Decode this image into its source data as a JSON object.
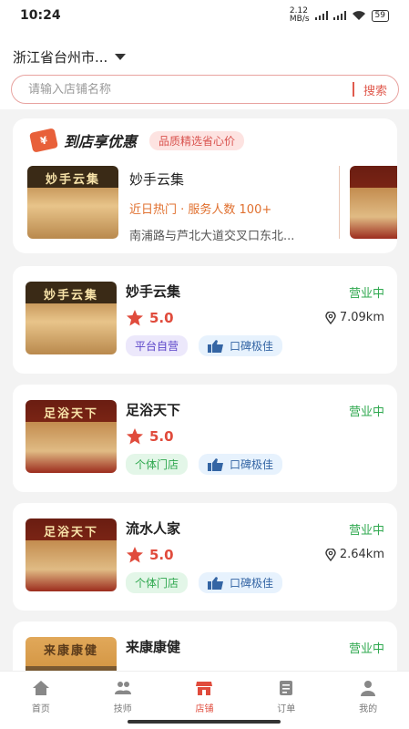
{
  "status_bar": {
    "time": "10:24",
    "net_speed": "2.12\nMB/s",
    "battery": "59"
  },
  "header": {
    "location": "浙江省台州市...",
    "search_placeholder": "请输入店铺名称",
    "search_button": "搜索"
  },
  "promo": {
    "title": "到店享优惠",
    "tag": "品质精选省心价",
    "store": {
      "name": "妙手云集",
      "hot": "近日热门 · 服务人数 100+",
      "address": "南浦路与芦北大道交叉口东北..."
    }
  },
  "stores": [
    {
      "name": "妙手云集",
      "status": "营业中",
      "rating": "5.0",
      "distance": "7.09km",
      "sign": "妙手云集",
      "tags": [
        "平台自营",
        "口碑极佳"
      ]
    },
    {
      "name": "足浴天下",
      "status": "营业中",
      "rating": "5.0",
      "distance": "",
      "sign": "足浴天下",
      "tags": [
        "个体门店",
        "口碑极佳"
      ]
    },
    {
      "name": "流水人家",
      "status": "营业中",
      "rating": "5.0",
      "distance": "2.64km",
      "sign": "足浴天下",
      "tags": [
        "个体门店",
        "口碑极佳"
      ]
    },
    {
      "name": "来康康健",
      "status": "营业中",
      "sign": "来康康健"
    }
  ],
  "tabbar": [
    {
      "label": "首页",
      "icon": "home-icon"
    },
    {
      "label": "技师",
      "icon": "people-icon"
    },
    {
      "label": "店铺",
      "icon": "shop-icon",
      "active": true
    },
    {
      "label": "订单",
      "icon": "order-icon"
    },
    {
      "label": "我的",
      "icon": "user-icon"
    }
  ],
  "colors": {
    "accent": "#e04b3c",
    "open": "#2fa84f"
  }
}
